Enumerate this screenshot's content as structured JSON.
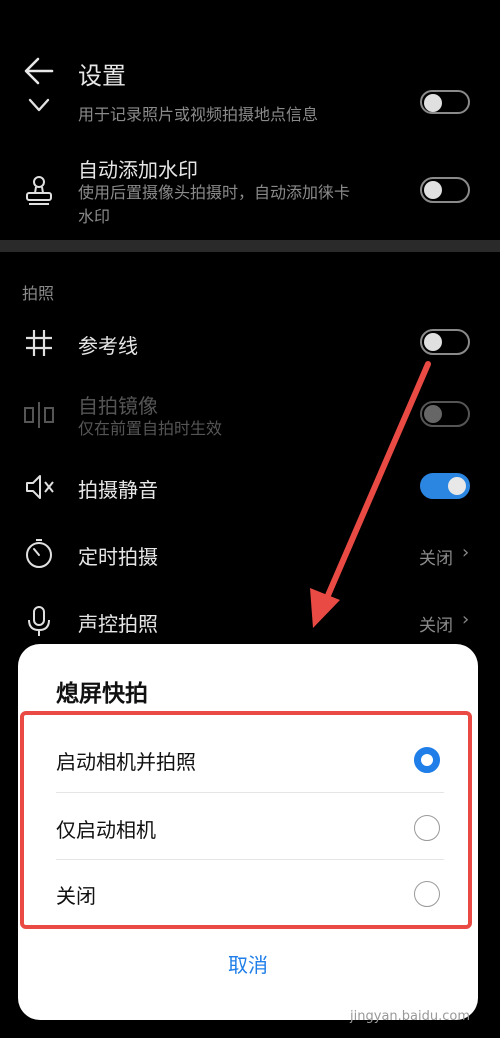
{
  "header": {
    "title": "设置"
  },
  "location": {
    "subtitle": "用于记录照片或视频拍摄地点信息"
  },
  "watermark_row": {
    "title": "自动添加水印",
    "subtitle_line1": "使用后置摄像头拍摄时，自动添加徕卡",
    "subtitle_line2": "水印"
  },
  "section": {
    "label": "拍照"
  },
  "rows": {
    "grid": {
      "title": "参考线"
    },
    "mirror": {
      "title": "自拍镜像",
      "subtitle": "仅在前置自拍时生效"
    },
    "mute": {
      "title": "拍摄静音"
    },
    "timer": {
      "title": "定时拍摄",
      "value": "关闭"
    },
    "voice": {
      "title": "声控拍照",
      "value": "关闭"
    }
  },
  "dialog": {
    "title": "熄屏快拍",
    "options": [
      "启动相机并拍照",
      "仅启动相机",
      "关闭"
    ],
    "selected_index": 0,
    "cancel_label": "取消"
  },
  "overlay": {
    "watermark_text": "jingyan.baidu.com"
  },
  "colors": {
    "accent": "#2a86e1",
    "annotation": "#e94a43",
    "dialog_accent": "#1f7ee8"
  }
}
